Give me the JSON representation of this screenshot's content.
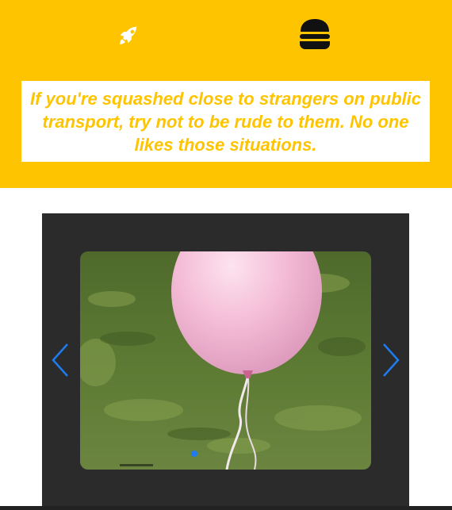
{
  "header": {
    "logo_icon": "rocket-icon",
    "menu_icon": "hamburger-icon",
    "background_color": "#FFC400",
    "icon_color": "#ffffff"
  },
  "quote": {
    "text": "If you're squashed close to strangers on public transport, try not to be rude to them. No one likes those situations.",
    "color": "#FFC400"
  },
  "carousel": {
    "prev_icon": "chevron-left-icon",
    "next_icon": "chevron-right-icon",
    "arrow_color": "#1E7BF0",
    "active_dot_color": "#1E7BF0",
    "slide_image": "pink balloon on grass"
  }
}
